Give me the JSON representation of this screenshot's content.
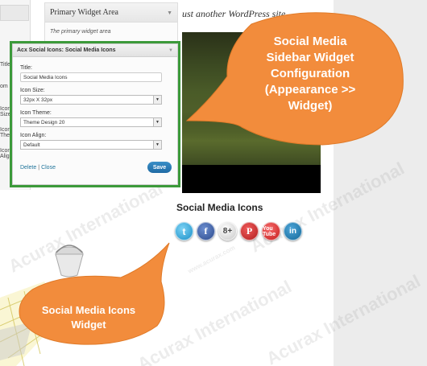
{
  "site": {
    "tagline": "ust another WordPress site"
  },
  "admin": {
    "left_labels": [
      "Title:",
      "om",
      "Icon Size:",
      "Icon Theme:",
      "Icon Align:"
    ],
    "primary_area": {
      "title": "Primary Widget Area",
      "description": "The primary widget area"
    }
  },
  "widget": {
    "header": "Acx Social Icons: Social Media Icons",
    "fields": [
      {
        "label": "Title:",
        "value": "Social Media Icons",
        "type": "input"
      },
      {
        "label": "Icon Size:",
        "value": "32px X 32px",
        "type": "select"
      },
      {
        "label": "Icon Theme:",
        "value": "Theme Design 20",
        "type": "select"
      },
      {
        "label": "Icon Align:",
        "value": "Default",
        "type": "select"
      }
    ],
    "delete_label": "Delete",
    "separator": "|",
    "close_label": "Close",
    "save_label": "Save"
  },
  "social": {
    "title": "Social Media Icons",
    "icons": [
      {
        "name": "twitter",
        "glyph": "t"
      },
      {
        "name": "facebook",
        "glyph": "f"
      },
      {
        "name": "google-plus",
        "glyph": "8+"
      },
      {
        "name": "pinterest",
        "glyph": "P"
      },
      {
        "name": "youtube",
        "glyph": "You Tube"
      },
      {
        "name": "linkedin",
        "glyph": "in"
      }
    ]
  },
  "callouts": {
    "top": "Social Media Sidebar Widget Configuration (Appearance >> Widget)",
    "top_lines": [
      "Social Media",
      "Sidebar Widget",
      "Configuration",
      "(Appearance >>",
      "Widget)"
    ],
    "bottom_lines": [
      "Social Media Icons",
      "Widget"
    ]
  },
  "colors": {
    "callout": "#f28c3c",
    "panel_border": "#3c9a3a",
    "link": "#21759b",
    "save_button": "#2a7ab8"
  },
  "watermark": {
    "text": "Acurax International",
    "url": "www.acurax.com"
  }
}
